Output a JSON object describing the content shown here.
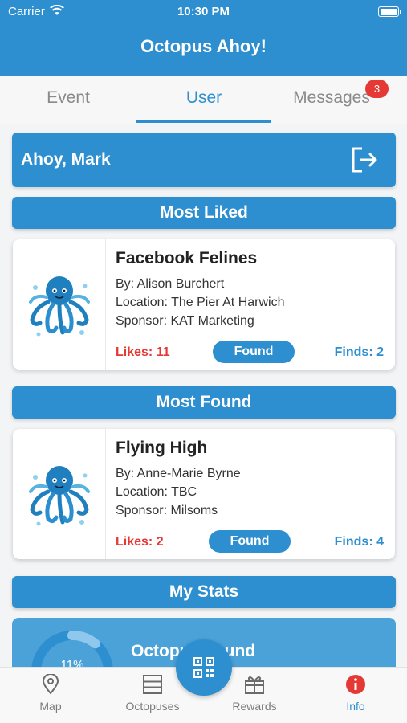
{
  "status_bar": {
    "carrier": "Carrier",
    "time": "10:30 PM"
  },
  "header": {
    "title": "Octopus Ahoy!"
  },
  "tabs": [
    {
      "label": "Event",
      "active": false
    },
    {
      "label": "User",
      "active": true
    },
    {
      "label": "Messages",
      "active": false,
      "badge": "3"
    }
  ],
  "greeting": {
    "text": "Ahoy, Mark",
    "icon": "logout-icon"
  },
  "sections": {
    "most_liked": "Most Liked",
    "most_found": "Most Found",
    "my_stats": "My Stats"
  },
  "cards": [
    {
      "title": "Facebook Felines",
      "by": "By: Alison Burchert",
      "location": "Location: The Pier At Harwich",
      "sponsor": "Sponsor: KAT Marketing",
      "likes": "Likes: 11",
      "button": "Found",
      "finds": "Finds: 2"
    },
    {
      "title": "Flying High",
      "by": "By: Anne-Marie Byrne",
      "location": "Location: TBC",
      "sponsor": "Sponsor: Milsoms",
      "likes": "Likes: 2",
      "button": "Found",
      "finds": "Finds: 4"
    }
  ],
  "stats": {
    "percent": "11%",
    "progress": 0.11,
    "label": "Octopus Found"
  },
  "bottom_nav": [
    {
      "label": "Map",
      "icon": "map-pin-icon"
    },
    {
      "label": "Octopuses",
      "icon": "list-icon"
    },
    {
      "label": "Rewards",
      "icon": "gift-icon"
    },
    {
      "label": "Info",
      "icon": "info-icon",
      "active": true
    }
  ],
  "fab": {
    "icon": "qr-code-icon"
  },
  "colors": {
    "primary": "#2d8fcf",
    "likes": "#e53935",
    "badge": "#e53935"
  }
}
